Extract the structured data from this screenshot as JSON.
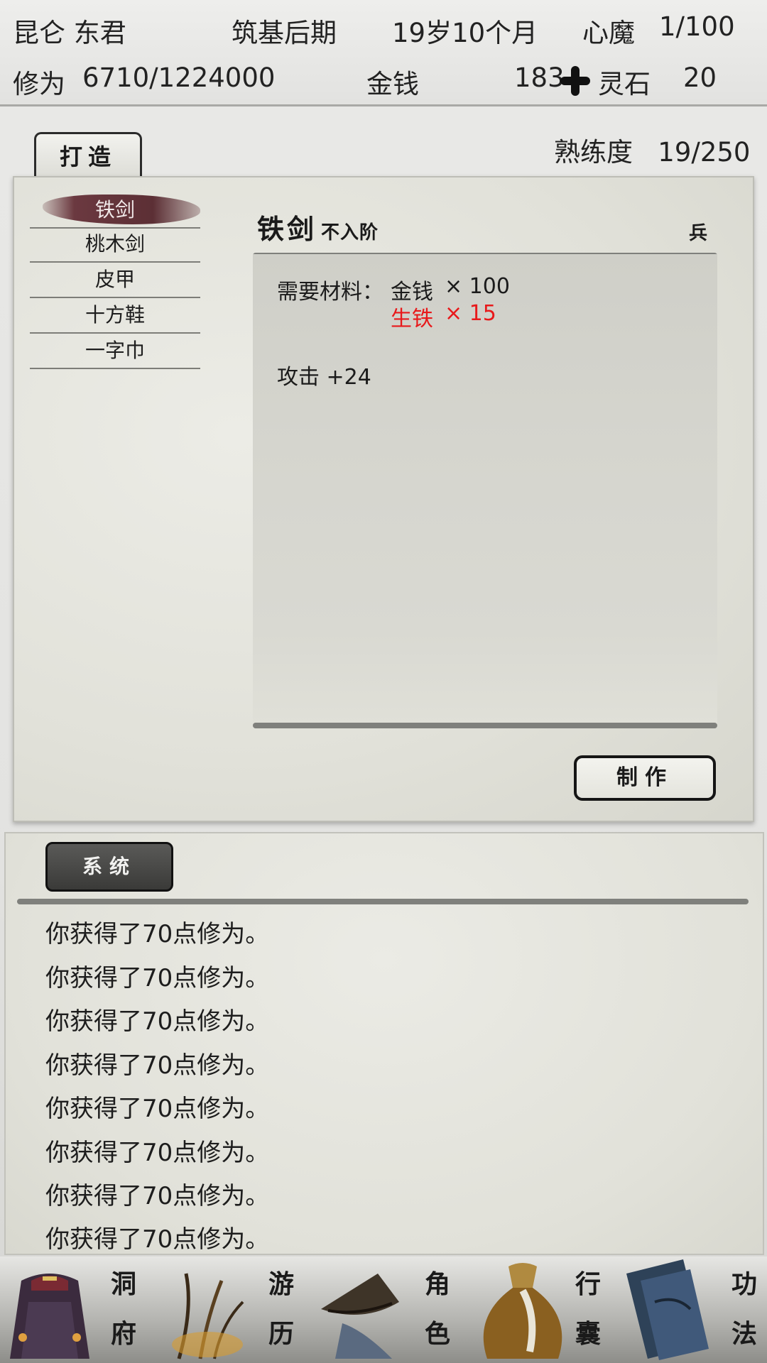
{
  "status": {
    "name": "昆仑 东君",
    "realm": "筑基后期",
    "age": "19岁10个月",
    "heart_demon_label": "心魔",
    "heart_demon_value": "1/100",
    "cultivation_label": "修为",
    "cultivation_value": "6710/1224000",
    "money_label": "金钱",
    "money_value": "183",
    "spirit_stone_label": "灵石",
    "spirit_stone_value": "20"
  },
  "forge": {
    "tab_label": "打造",
    "proficiency_label": "熟练度",
    "proficiency_value": "19/250",
    "items": [
      "铁剑",
      "桃木剑",
      "皮甲",
      "十方鞋",
      "一字巾"
    ],
    "selected_index": 0,
    "detail": {
      "name": "铁剑",
      "grade": "不入阶",
      "type": "兵",
      "materials_label": "需要材料：",
      "materials": [
        {
          "name": "金钱",
          "qty": "× 100",
          "insufficient": false
        },
        {
          "name": "生铁",
          "qty": "× 15",
          "insufficient": true
        }
      ],
      "effect": "攻击 +24"
    },
    "make_button": "制作"
  },
  "log": {
    "tab_label": "系统",
    "lines": [
      "你获得了70点修为。",
      "你获得了70点修为。",
      "你获得了70点修为。",
      "你获得了70点修为。",
      "你获得了70点修为。",
      "你获得了70点修为。",
      "你获得了70点修为。",
      "你获得了70点修为。"
    ]
  },
  "nav": {
    "items": [
      {
        "label_top": "洞",
        "label_bottom": "府",
        "icon": "cave-mansion-icon"
      },
      {
        "label_top": "游",
        "label_bottom": "历",
        "icon": "travel-icon"
      },
      {
        "label_top": "角",
        "label_bottom": "色",
        "icon": "character-icon"
      },
      {
        "label_top": "行",
        "label_bottom": "囊",
        "icon": "bag-icon"
      },
      {
        "label_top": "功",
        "label_bottom": "法",
        "icon": "skills-book-icon"
      }
    ]
  },
  "colors": {
    "insufficient": "#e8191b",
    "selected_brush": "#5c2f35"
  }
}
